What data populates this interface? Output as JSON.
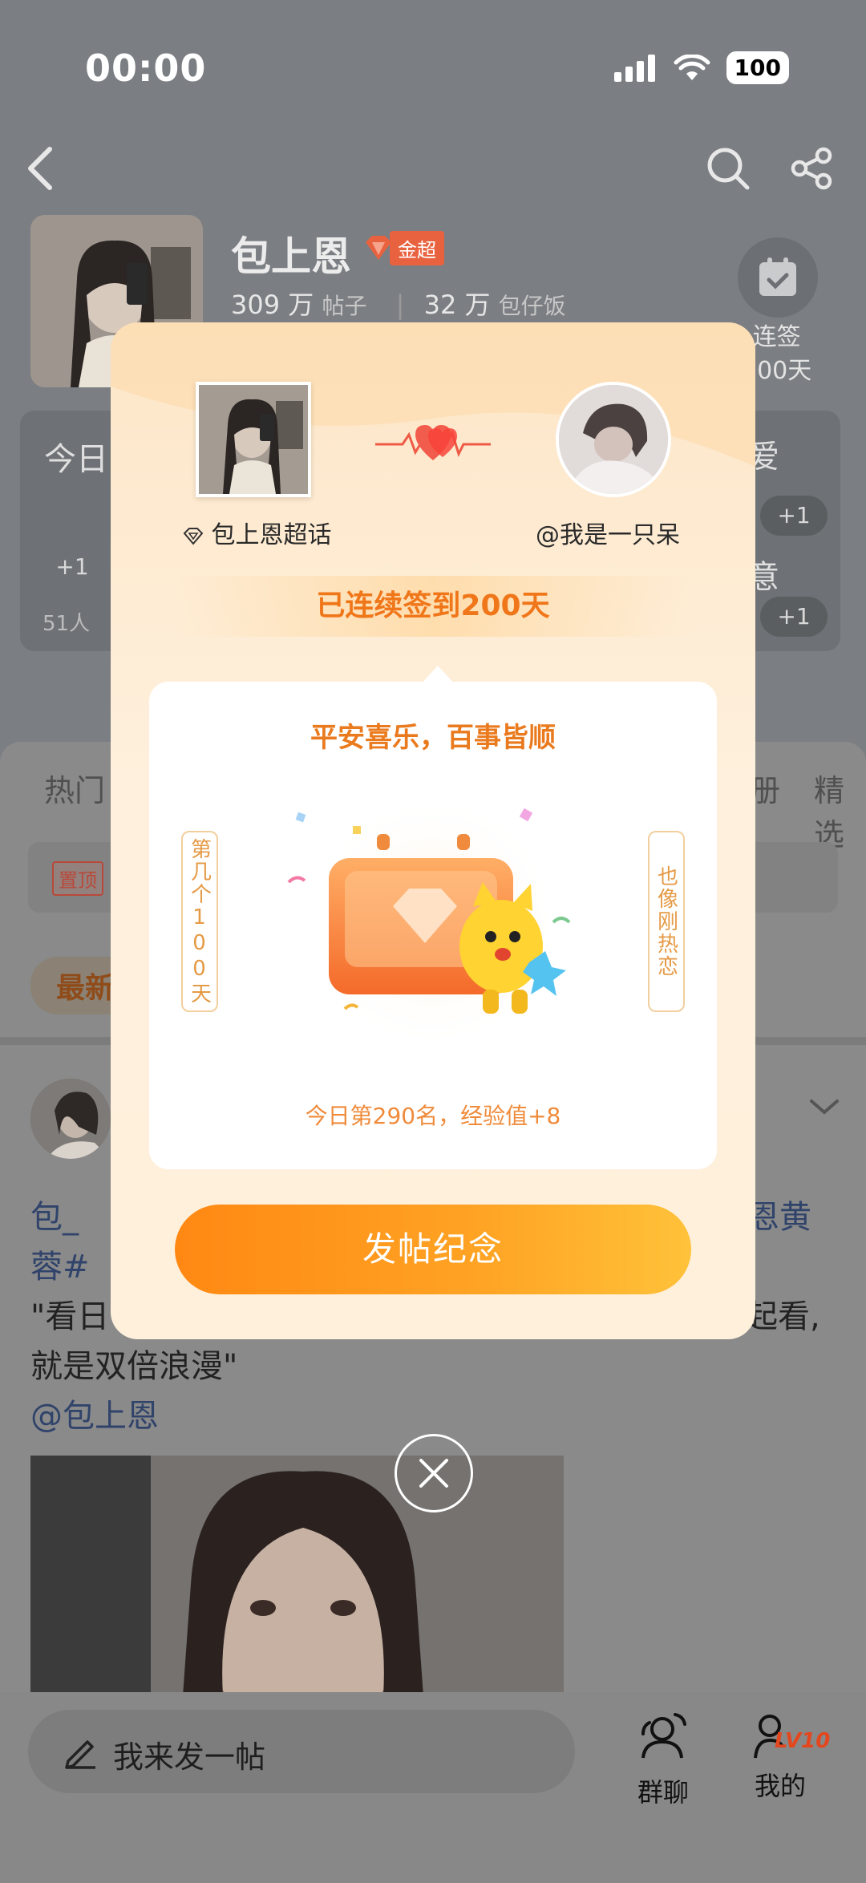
{
  "status_bar": {
    "time": "00:00",
    "battery": "100"
  },
  "profile": {
    "name": "包上恩",
    "badge": "金超",
    "posts_count": "309 万",
    "posts_label": "帖子",
    "fans_count": "32 万",
    "fans_label": "包仔饭",
    "checkin_label_line1": "连签",
    "checkin_label_line2": "200天"
  },
  "cards": {
    "left_title": "今日",
    "left_count": "51人",
    "right_title_1": "爱",
    "right_title_2": "意",
    "plus_one": "+1"
  },
  "tabs": {
    "left": "热门",
    "right_1": "册",
    "right_2": "精选"
  },
  "pinned_tag": "置顶",
  "latest_label": "最新",
  "post": {
    "line1_left": "包_",
    "line1_right": "恩黄",
    "line2": "蓉#",
    "line3_left": "\"看日",
    "line3_right": "起看,",
    "line4": "就是双倍浪漫\"",
    "mention": "@包上恩"
  },
  "bottom_bar": {
    "composer_placeholder": "我来发一帖",
    "group_chat": "群聊",
    "mine": "我的",
    "level": "LV10"
  },
  "modal": {
    "left_name": "包上恩超话",
    "right_name": "@我是一只呆",
    "streak_text": "已连续签到200天",
    "blessing": "平安喜乐，百事皆顺",
    "side_left": "第几个100天",
    "side_right": "也像刚热恋",
    "rank_text": "今日第290名，经验值+8",
    "post_button": "发帖纪念"
  }
}
